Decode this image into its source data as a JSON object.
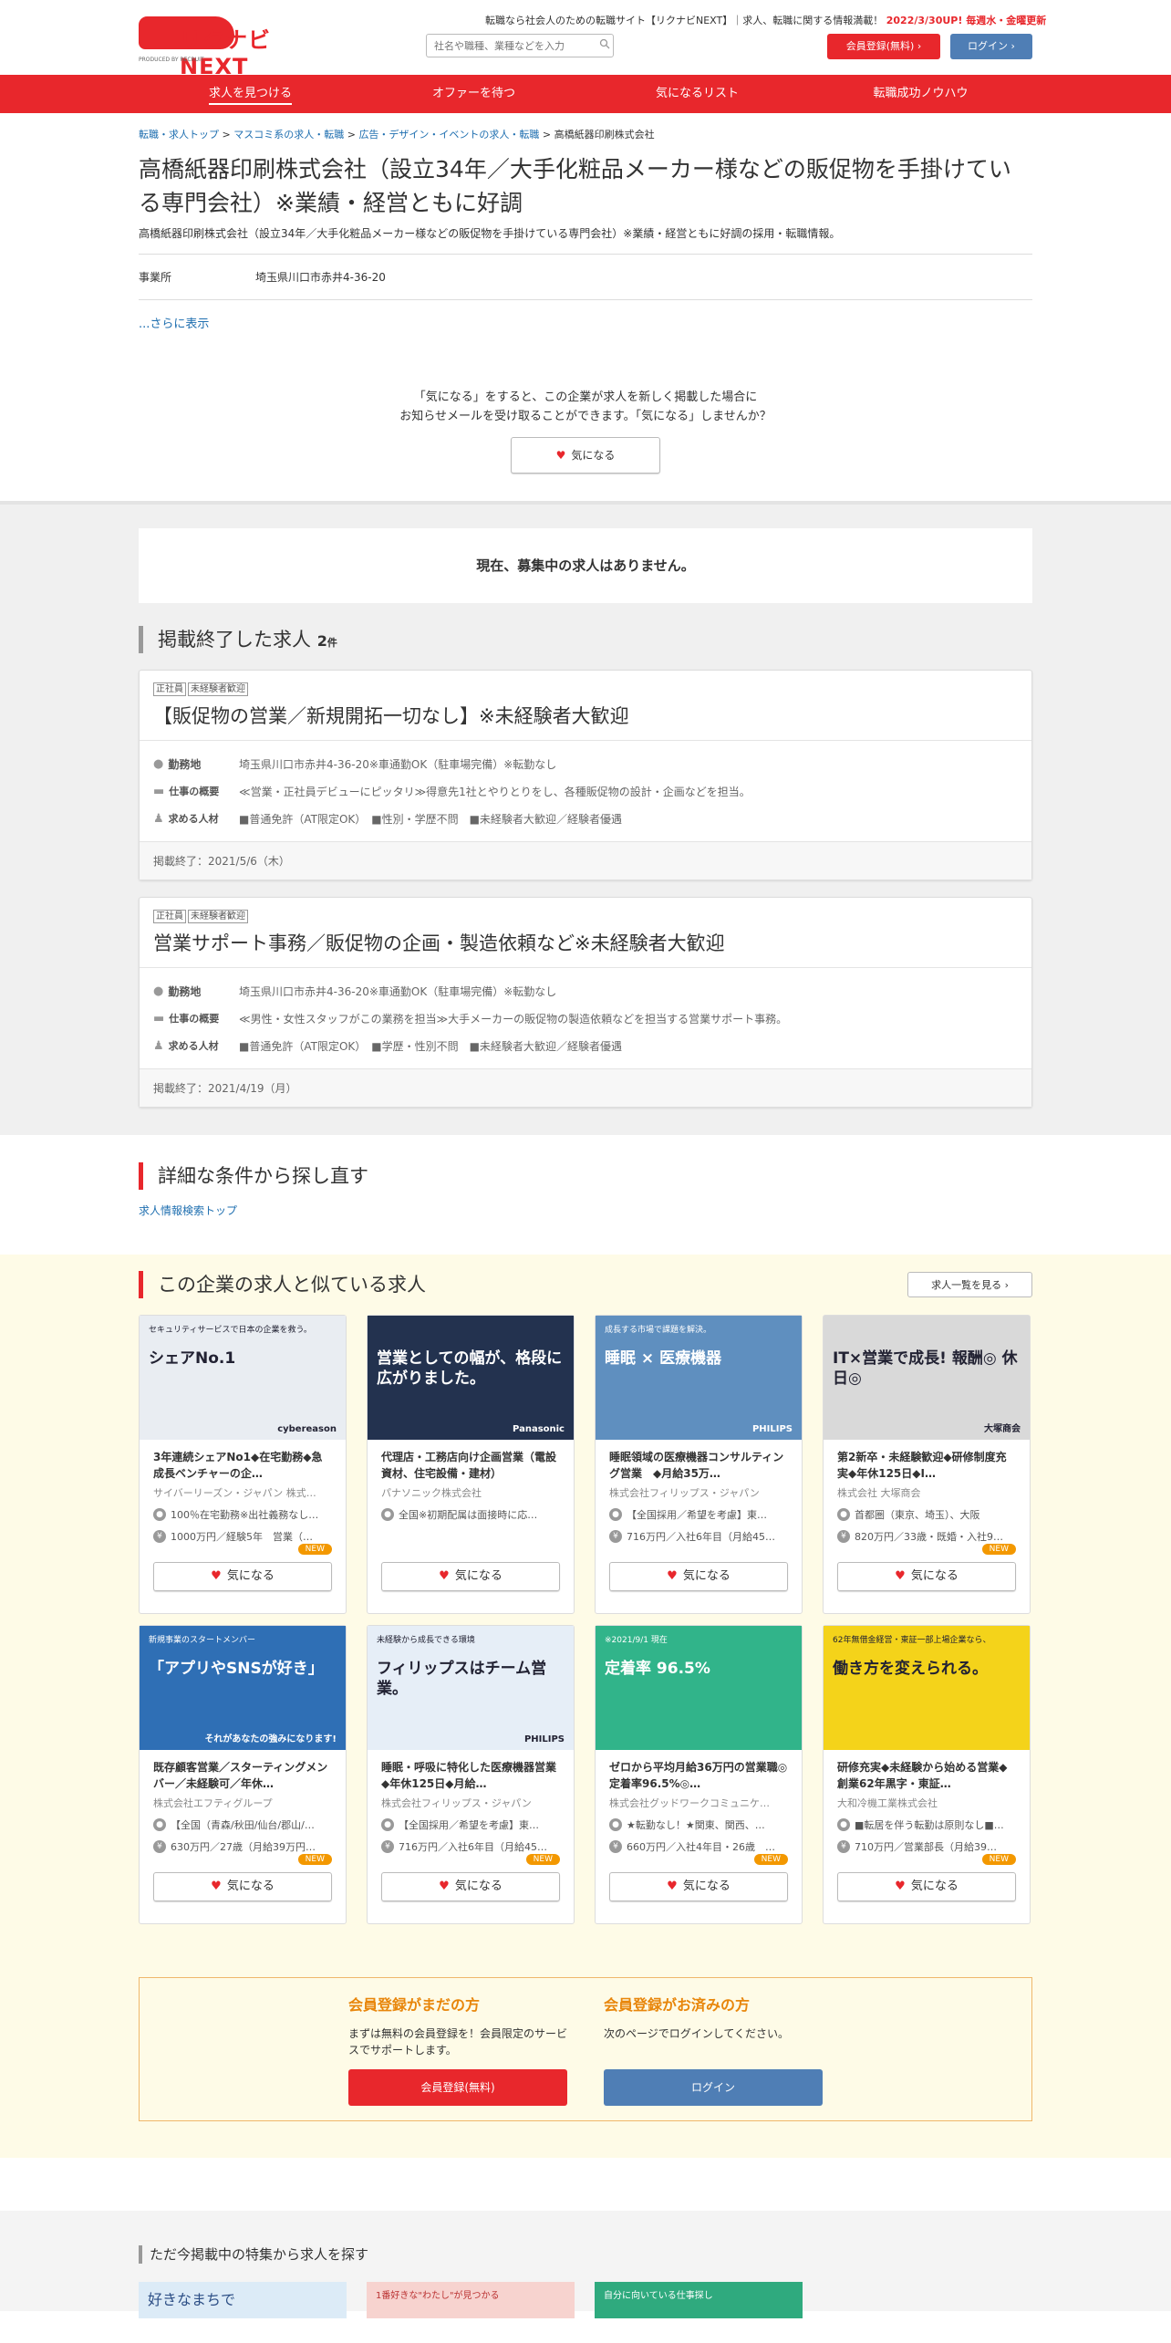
{
  "header": {
    "logo_text": "リクナビNEXT",
    "logo_sub": "PRODUCED BY RECRUIT",
    "tagline": "転職なら社会人のための転職サイト【リクナビNEXT】｜求人、転職に関する情報満載！",
    "update": "2022/3/30UP! 毎週水・金曜更新",
    "search_placeholder": "社名や職種、業種などを入力",
    "register_button": "会員登録(無料)",
    "login_button": "ログイン"
  },
  "nav": [
    "求人を見つける",
    "オファーを待つ",
    "気になるリスト",
    "転職成功ノウハウ"
  ],
  "breadcrumb": [
    "転職・求人トップ",
    "マスコミ系の求人・転職",
    "広告・デザイン・イベントの求人・転職",
    "高橋紙器印刷株式会社"
  ],
  "company": {
    "title": "高橋紙器印刷株式会社（設立34年／大手化粧品メーカー様などの販促物を手掛けている専門会社）※業績・経営ともに好調",
    "subtitle": "高橋紙器印刷株式会社（設立34年／大手化粧品メーカー様などの販促物を手掛けている専門会社）※業績・経営ともに好調の採用・転職情報。",
    "office_label": "事業所",
    "office_value": "埼玉県川口市赤井4-36-20",
    "more": "...さらに表示"
  },
  "favorite": {
    "message1": "「気になる」をすると、この企業が求人を新しく掲載した場合に",
    "message2": "お知らせメールを受け取ることができます。「気になる」しませんか？",
    "button": "気になる"
  },
  "no_jobs": "現在、募集中の求人はありません。",
  "ended": {
    "heading": "掲載終了した求人",
    "count": "2",
    "unit": "件",
    "jobs": [
      {
        "tags": [
          "正社員",
          "未経験者歓迎"
        ],
        "title": "【販促物の営業／新規開拓一切なし】※未経験者大歓迎",
        "loc_label": "勤務地",
        "loc": "埼玉県川口市赤井4-36-20※車通勤OK（駐車場完備）※転勤なし",
        "desc_label": "仕事の概要",
        "desc": "≪営業・正社員デビューにピッタリ≫得意先1社とやりとりをし、各種販促物の設計・企画などを担当。",
        "req_label": "求める人材",
        "req": "■普通免許（AT限定OK）　■性別・学歴不問　■未経験者大歓迎／経験者優遇",
        "end": "掲載終了：2021/5/6（木）"
      },
      {
        "tags": [
          "正社員",
          "未経験者歓迎"
        ],
        "title": "営業サポート事務／販促物の企画・製造依頼など※未経験者大歓迎",
        "loc_label": "勤務地",
        "loc": "埼玉県川口市赤井4-36-20※車通勤OK（駐車場完備）※転勤なし",
        "desc_label": "仕事の概要",
        "desc": "≪男性・女性スタッフがこの業務を担当≫大手メーカーの販促物の製造依頼などを担当する営業サポート事務。",
        "req_label": "求める人材",
        "req": "■普通免許（AT限定OK）　■学歴・性別不問　■未経験者大歓迎／経験者優遇",
        "end": "掲載終了：2021/4/19（月）"
      }
    ]
  },
  "research": {
    "heading": "詳細な条件から探し直す",
    "link": "求人情報検索トップ"
  },
  "similar": {
    "heading": "この企業の求人と似ている求人",
    "list_button": "求人一覧を見る",
    "fav_label": "気になる",
    "new_label": "NEW",
    "cards": [
      {
        "img_text": "シェアNo.1",
        "img_sub": "セキュリティサービスで日本の企業を救う。",
        "img_brand": "cybereason",
        "bg": "#e9edf2",
        "title": "3年連続シェアNo1◆在宅勤務◆急成長ベンチャーの企…",
        "company": "サイバーリーズン・ジャパン 株式…",
        "loc": "100％在宅勤務※出社義務なし…",
        "pay": "1000万円／経験5年　営業（…",
        "new": true
      },
      {
        "img_text": "営業としての幅が、格段に広がりました。",
        "img_sub": "",
        "img_brand": "Panasonic",
        "bg": "#23324f",
        "title": "代理店・工務店向け企画営業（電設資材、住宅設備・建材）",
        "company": "パナソニック株式会社",
        "loc": "全国※初期配属は面接時に応…",
        "pay": "",
        "new": false
      },
      {
        "img_text": "睡眠 × 医療機器",
        "img_sub": "成長する市場で課題を解決。",
        "img_brand": "PHILIPS",
        "bg": "#5f8fbf",
        "title": "睡眠領域の医療機器コンサルティング営業　◆月給35万…",
        "company": "株式会社フィリップス・ジャパン",
        "loc": "【全国採用／希望を考慮】東…",
        "pay": "716万円／入社6年目（月給45…",
        "new": false
      },
      {
        "img_text": "IT×営業で成長! 報酬◎ 休日◎",
        "img_sub": "",
        "img_brand": "大塚商会",
        "bg": "#d9d9d9",
        "title": "第2新卒・未経験歓迎◆研修制度充実◆年休125日◆I…",
        "company": "株式会社 大塚商会",
        "loc": "首都圏（東京、埼玉）、大阪",
        "pay": "820万円／33歳・既婚・入社9…",
        "new": true
      },
      {
        "img_text": "「アプリやSNSが好き」",
        "img_sub": "新規事業のスタートメンバー",
        "img_brand": "それがあなたの強みになります!",
        "bg": "#2f6fb5",
        "title": "既存顧客営業／スターティングメンバー／未経験可／年休…",
        "company": "株式会社エフティグループ",
        "loc": "【全国（青森/秋田/仙台/郡山/…",
        "pay": "630万円／27歳（月給39万円…",
        "new": true
      },
      {
        "img_text": "フィリップスはチーム営業。",
        "img_sub": "未経験から成長できる環境",
        "img_brand": "PHILIPS",
        "bg": "#e6eef7",
        "title": "睡眠・呼吸に特化した医療機器営業◆年休125日◆月給…",
        "company": "株式会社フィリップス・ジャパン",
        "loc": "【全国採用／希望を考慮】東…",
        "pay": "716万円／入社6年目（月給45…",
        "new": true
      },
      {
        "img_text": "定着率 96.5%",
        "img_sub": "※2021/9/1 現在",
        "img_brand": "",
        "bg": "#31b48a",
        "title": "ゼロから平均月給36万円の営業職◎定着率96.5%◎…",
        "company": "株式会社グッドワークコミュニケ…",
        "loc": "★転勤なし！★関東、関西、…",
        "pay": "660万円／入社4年目・26歳　…",
        "new": true
      },
      {
        "img_text": "働き方を変えられる。",
        "img_sub": "62年無借金経営・東証一部上場企業なら、",
        "img_brand": "",
        "bg": "#f4d31a",
        "title": "研修充実◆未経験から始める営業◆創業62年黒字・東証…",
        "company": "大和冷機工業株式会社",
        "loc": "■転居を伴う転勤は原則なし■…",
        "pay": "710万円／営業部長（月給39…",
        "new": true
      }
    ]
  },
  "register": {
    "new_heading": "会員登録がまだの方",
    "new_text": "まずは無料の会員登録を！会員限定のサービスでサポートします。",
    "new_button": "会員登録(無料)",
    "member_heading": "会員登録がお済みの方",
    "member_text": "次のページでログインしてください。",
    "member_button": "ログイン"
  },
  "features": {
    "heading": "ただ今掲載中の特集から求人を探す",
    "banners": [
      "好きなまちで",
      "1番好きな\"わたし\"が見つかる",
      "自分に向いている仕事探し"
    ]
  },
  "colors": {
    "brand_red": "#e8272c",
    "login_blue": "#4f7eb5",
    "link_blue": "#1f6fb0",
    "new_orange": "#f39800"
  }
}
